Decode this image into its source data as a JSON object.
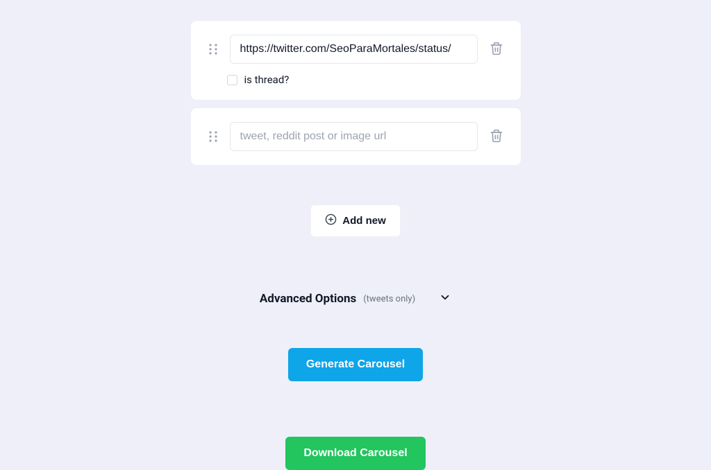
{
  "cards": [
    {
      "value": "https://twitter.com/SeoParaMortales/status/",
      "placeholder": "tweet, reddit post or image url",
      "showThread": true,
      "threadLabel": "is thread?"
    },
    {
      "value": "",
      "placeholder": "tweet, reddit post or image url",
      "showThread": false,
      "threadLabel": ""
    }
  ],
  "addNewLabel": "Add new",
  "advanced": {
    "title": "Advanced Options",
    "subtitle": "(tweets only)"
  },
  "generateLabel": "Generate Carousel",
  "downloadLabel": "Download Carousel"
}
